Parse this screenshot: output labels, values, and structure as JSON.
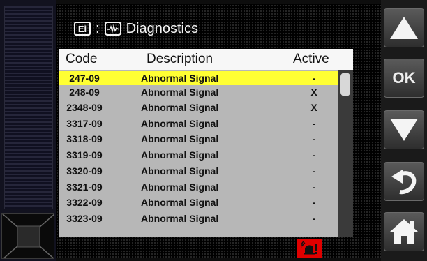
{
  "screen": {
    "title_icon_label": "Ei",
    "title_separator": ":",
    "title": "Diagnostics"
  },
  "table": {
    "headers": {
      "code": "Code",
      "description": "Description",
      "active": "Active"
    },
    "rows": [
      {
        "code": "247-09",
        "description": "Abnormal Signal",
        "active": "-",
        "selected": true
      },
      {
        "code": "248-09",
        "description": "Abnormal Signal",
        "active": "X"
      },
      {
        "code": "2348-09",
        "description": "Abnormal Signal",
        "active": "X"
      },
      {
        "code": "3317-09",
        "description": "Abnormal Signal",
        "active": "-"
      },
      {
        "code": "3318-09",
        "description": "Abnormal Signal",
        "active": "-"
      },
      {
        "code": "3319-09",
        "description": "Abnormal Signal",
        "active": "-"
      },
      {
        "code": "3320-09",
        "description": "Abnormal Signal",
        "active": "-"
      },
      {
        "code": "3321-09",
        "description": "Abnormal Signal",
        "active": "-"
      },
      {
        "code": "3322-09",
        "description": "Abnormal Signal",
        "active": "-"
      },
      {
        "code": "3323-09",
        "description": "Abnormal Signal",
        "active": "-"
      }
    ]
  },
  "nav": {
    "up_icon": "triangle-up-icon",
    "ok_label": "OK",
    "down_icon": "triangle-down-icon",
    "back_icon": "return-arrow-icon",
    "home_icon": "home-icon"
  },
  "status": {
    "alert_icon": "alarm-bell-icon"
  },
  "colors": {
    "selected_row": "#ffff33",
    "list_background": "#b7b7b7",
    "alert_background": "#e00000"
  }
}
